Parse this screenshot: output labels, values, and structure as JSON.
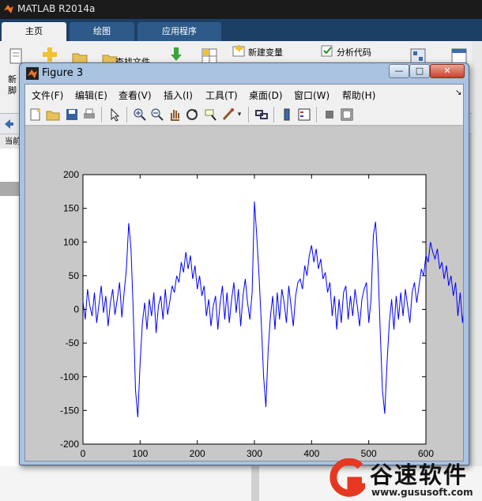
{
  "app": {
    "title": "MATLAB R2014a"
  },
  "ribbon_tabs": [
    "主页",
    "绘图",
    "应用程序"
  ],
  "ribbon": {
    "new_variable": "新建变量",
    "analyze_code": "分析代码",
    "find_files_partial": "查找文件",
    "new_script_partial_1": "新",
    "new_script_partial_2": "脚"
  },
  "left_panel": {
    "header": "当前"
  },
  "figure": {
    "title": "Figure 3",
    "menus": [
      "文件(F)",
      "编辑(E)",
      "查看(V)",
      "插入(I)",
      "工具(T)",
      "桌面(D)",
      "窗口(W)",
      "帮助(H)"
    ],
    "toolbar": [
      "new-figure-icon",
      "open-file-icon",
      "save-icon",
      "print-icon",
      "edit-plot-arrow-icon",
      "zoom-in-icon",
      "zoom-out-icon",
      "pan-hand-icon",
      "rotate-3d-icon",
      "data-cursor-icon",
      "brush-icon",
      "link-plot-icon",
      "colorbar-icon",
      "legend-icon",
      "hide-plot-tools-icon",
      "show-plot-tools-icon"
    ],
    "window_buttons": {
      "minimize": "—",
      "maximize": "□",
      "close": "✕"
    }
  },
  "chart_data": {
    "type": "line",
    "title": "",
    "xlabel": "",
    "ylabel": "",
    "xlim": [
      0,
      600
    ],
    "ylim": [
      -200,
      200
    ],
    "xticks": [
      0,
      100,
      200,
      300,
      400,
      500,
      600
    ],
    "yticks": [
      200,
      150,
      100,
      50,
      0,
      -50,
      -100,
      -150,
      -200
    ],
    "grid": false,
    "color": "#0000ff",
    "series": [
      {
        "x_start": 0,
        "x_step": 4,
        "values": [
          12,
          -15,
          30,
          5,
          -10,
          25,
          -20,
          8,
          35,
          -5,
          20,
          -25,
          10,
          30,
          -8,
          15,
          40,
          -12,
          25,
          60,
          128,
          90,
          -5,
          -120,
          -160,
          -80,
          -20,
          10,
          -30,
          15,
          -10,
          25,
          -35,
          5,
          20,
          -15,
          30,
          -8,
          12,
          35,
          25,
          50,
          40,
          70,
          55,
          85,
          60,
          80,
          45,
          65,
          30,
          50,
          20,
          35,
          -10,
          15,
          -25,
          5,
          20,
          -30,
          10,
          35,
          -15,
          25,
          -20,
          15,
          40,
          -5,
          30,
          -25,
          20,
          45,
          10,
          -15,
          25,
          160,
          110,
          50,
          -20,
          -100,
          -145,
          -60,
          -10,
          20,
          -30,
          25,
          -15,
          30,
          10,
          -20,
          35,
          5,
          -25,
          20,
          40,
          45,
          30,
          65,
          50,
          80,
          95,
          70,
          90,
          60,
          75,
          45,
          55,
          25,
          40,
          -10,
          20,
          -30,
          15,
          -20,
          25,
          35,
          -15,
          20,
          -10,
          30,
          5,
          -25,
          15,
          30,
          40,
          -20,
          15,
          110,
          130,
          70,
          -30,
          -120,
          -155,
          -80,
          -20,
          15,
          -30,
          20,
          -15,
          25,
          -10,
          30,
          5,
          -20,
          25,
          40,
          10,
          35,
          60,
          50,
          80,
          70,
          100,
          85,
          75,
          90,
          60,
          70,
          45,
          65,
          35,
          50,
          20,
          40,
          -10,
          25,
          -20,
          15,
          30,
          35,
          -25,
          10,
          -15,
          25,
          -5,
          20
        ]
      }
    ]
  },
  "watermark": {
    "name": "谷速软件",
    "url": "www.gususoft.com"
  }
}
